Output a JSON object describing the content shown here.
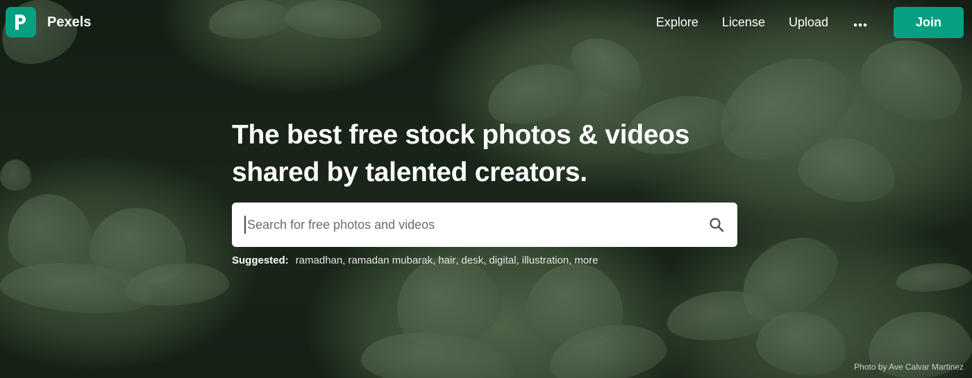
{
  "brand": {
    "name": "Pexels",
    "accent": "#05a081"
  },
  "nav": {
    "items": [
      {
        "label": "Explore"
      },
      {
        "label": "License"
      },
      {
        "label": "Upload"
      }
    ],
    "more_icon": "more-dots-icon",
    "join_label": "Join"
  },
  "hero": {
    "title_line1": "The best free stock photos & videos",
    "title_line2": "shared by talented creators.",
    "search": {
      "placeholder": "Search for free photos and videos",
      "icon": "search-icon"
    },
    "suggested_label": "Suggested:",
    "suggestions": [
      "ramadhan",
      "ramadan mubarak",
      "hair",
      "desk",
      "digital",
      "illustration",
      "more"
    ],
    "credit": "Photo by Ave Calvar Martinez"
  }
}
